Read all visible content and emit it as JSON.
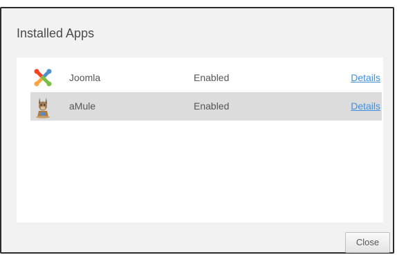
{
  "dialog": {
    "title": "Installed Apps",
    "close_label": "Close"
  },
  "apps": [
    {
      "icon": "joomla-logo-icon",
      "name": "Joomla",
      "status": "Enabled",
      "details_label": "Details",
      "selected": false
    },
    {
      "icon": "amule-mule-icon",
      "name": "aMule",
      "status": "Enabled",
      "details_label": "Details",
      "selected": true
    }
  ],
  "colors": {
    "link": "#3c8fe0",
    "selected_row": "#dcdcdc",
    "dialog_bg": "#f2f2f2"
  }
}
